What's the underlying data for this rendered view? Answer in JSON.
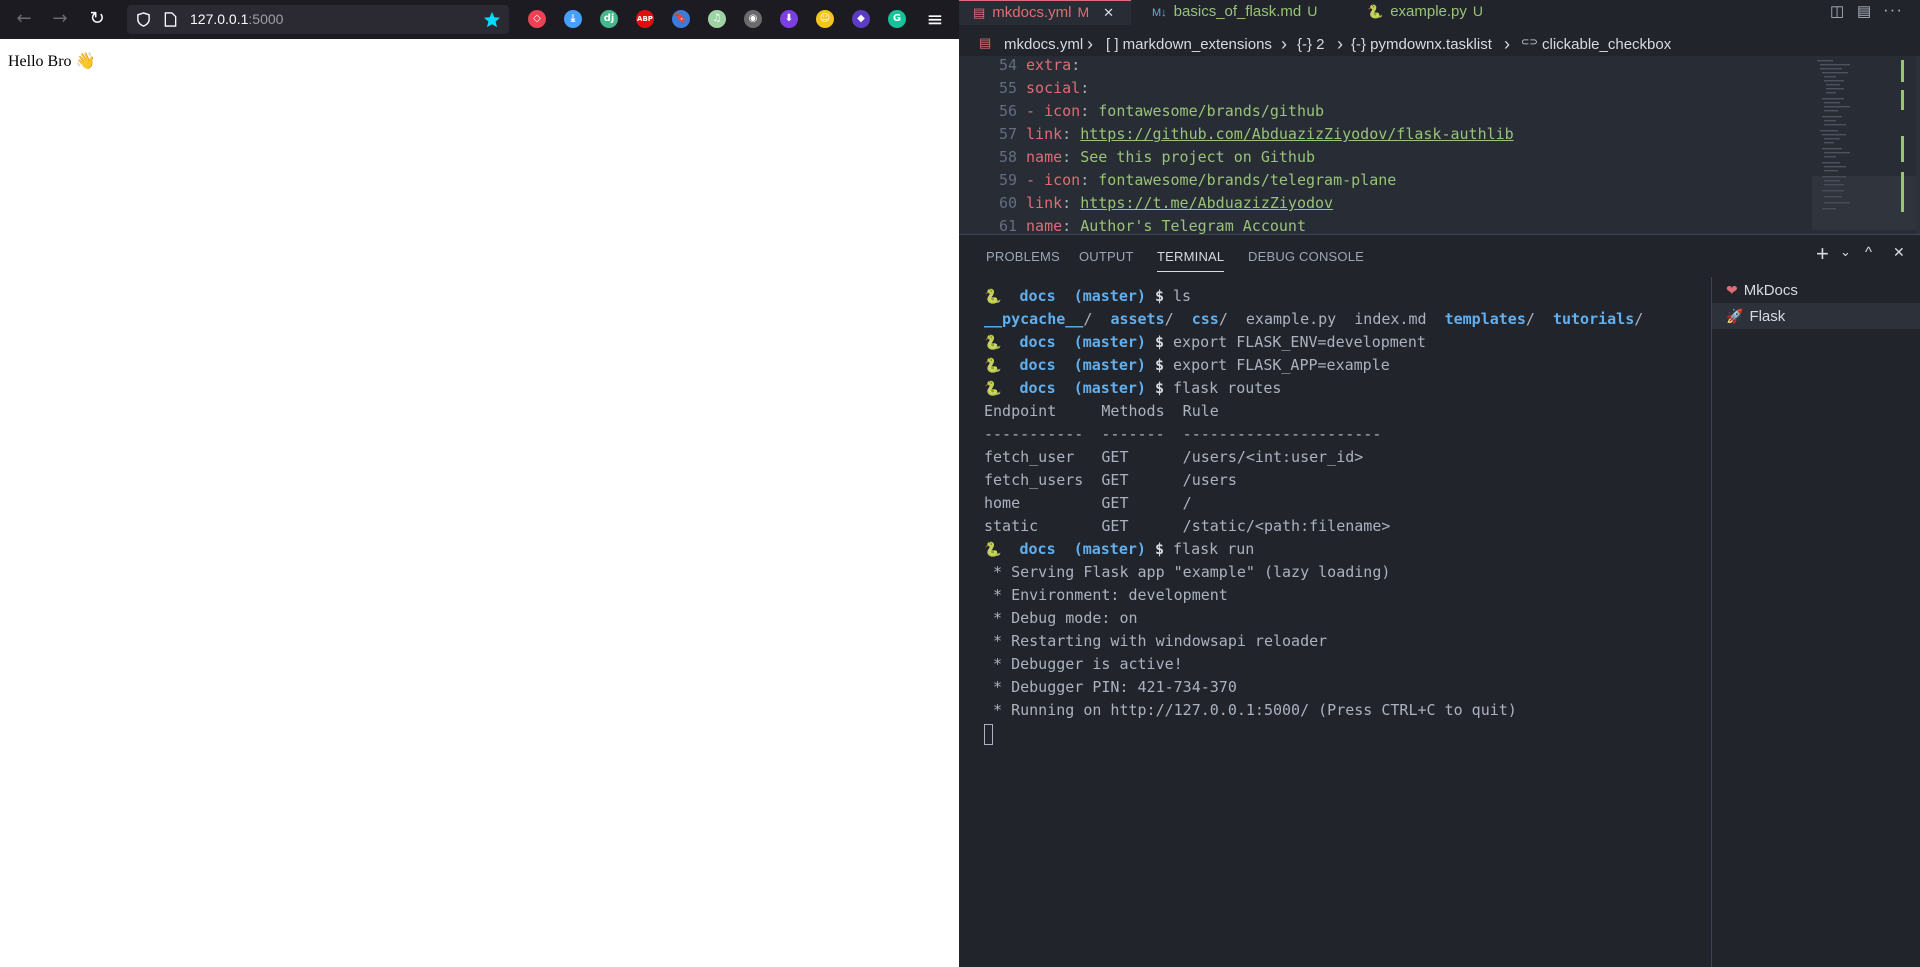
{
  "browser": {
    "url_host": "127.0.0.1",
    "url_port": ":5000",
    "page_text": "Hello Bro",
    "page_emoji": "👋",
    "nav": {
      "back": "←",
      "forward": "→",
      "reload": "↻"
    },
    "menu_icon": "≡",
    "extensions": [
      {
        "name": "pocket-icon",
        "glyph": "◇",
        "color": "#ef4056"
      },
      {
        "name": "download-icon",
        "glyph": "⤓",
        "color": "#45a1ff"
      },
      {
        "name": "dj-icon",
        "glyph": "dj",
        "color": "#44b78b"
      },
      {
        "name": "adblock-icon",
        "glyph": "ABP",
        "color": "#e40d0d"
      },
      {
        "name": "bookmark-icon",
        "glyph": "🔖",
        "color": "#3b7bdc"
      },
      {
        "name": "music-icon",
        "glyph": "♫",
        "color": "#9fd3a6"
      },
      {
        "name": "spy-icon",
        "glyph": "◉",
        "color": "#6b6b6b"
      },
      {
        "name": "ext-download-icon",
        "glyph": "⬇",
        "color": "#7b3fe4"
      },
      {
        "name": "emoji-icon",
        "glyph": "☺",
        "color": "#f5c518"
      },
      {
        "name": "layers-icon",
        "glyph": "◆",
        "color": "#5b3cc4"
      },
      {
        "name": "grammarly-icon",
        "glyph": "G",
        "color": "#15c39a"
      }
    ]
  },
  "vscode": {
    "tabs": [
      {
        "label": "mkdocs.yml",
        "badge": "M",
        "color": "#e06c75",
        "icon": "▤"
      },
      {
        "label": "basics_of_flask.md",
        "badge": "U",
        "color": "#98c379",
        "icon": "M↓"
      },
      {
        "label": "example.py",
        "badge": "U",
        "color": "#98c379",
        "icon": "🐍"
      }
    ],
    "breadcrumb": [
      "mkdocs.yml",
      "[ ] markdown_extensions",
      "{-} 2",
      "{-} pymdownx.tasklist",
      "clickable_checkbox"
    ],
    "code": [
      {
        "n": "54",
        "indent": "  ",
        "parts": [
          [
            "k",
            "extra"
          ],
          [
            "p",
            ":"
          ]
        ]
      },
      {
        "n": "55",
        "indent": "    ",
        "parts": [
          [
            "k",
            "social"
          ],
          [
            "p",
            ":"
          ]
        ]
      },
      {
        "n": "56",
        "indent": "      ",
        "parts": [
          [
            "k",
            "- icon"
          ],
          [
            "p",
            ": "
          ],
          [
            "s",
            "fontawesome/brands/github"
          ]
        ]
      },
      {
        "n": "57",
        "indent": "        ",
        "parts": [
          [
            "k",
            "link"
          ],
          [
            "p",
            ": "
          ],
          [
            "u",
            "https://github.com/AbduazizZiyodov/flask-authlib"
          ]
        ]
      },
      {
        "n": "58",
        "indent": "        ",
        "parts": [
          [
            "k",
            "name"
          ],
          [
            "p",
            ": "
          ],
          [
            "s",
            "See this project on Github"
          ]
        ]
      },
      {
        "n": "59",
        "indent": "      ",
        "parts": [
          [
            "k",
            "- icon"
          ],
          [
            "p",
            ": "
          ],
          [
            "s",
            "fontawesome/brands/telegram-plane"
          ]
        ]
      },
      {
        "n": "60",
        "indent": "        ",
        "parts": [
          [
            "k",
            "link"
          ],
          [
            "p",
            ": "
          ],
          [
            "u",
            "https://t.me/AbduazizZiyodov"
          ]
        ]
      },
      {
        "n": "61",
        "indent": "        ",
        "parts": [
          [
            "k",
            "name"
          ],
          [
            "p",
            ": "
          ],
          [
            "s",
            "Author's Telegram Account"
          ]
        ]
      }
    ],
    "panel_tabs": [
      "PROBLEMS",
      "OUTPUT",
      "TERMINAL",
      "DEBUG CONSOLE"
    ],
    "active_panel_tab": "TERMINAL",
    "panel_actions": {
      "add": "+",
      "chevron": "⌄",
      "maximize": "^",
      "close": "✕"
    },
    "terminals": [
      {
        "label": "MkDocs",
        "icon": "❤"
      },
      {
        "label": "Flask",
        "icon": "🚀"
      }
    ],
    "terminal_lines": [
      {
        "type": "prompt",
        "dir": "docs",
        "branch": "(master)",
        "cmd": "ls"
      },
      {
        "type": "ls",
        "items": [
          [
            "__pycache__",
            "dir"
          ],
          [
            "/",
            "p"
          ],
          [
            "  ",
            "p"
          ],
          [
            "assets",
            "dir"
          ],
          [
            "/",
            "p"
          ],
          [
            "  ",
            "p"
          ],
          [
            "css",
            "dir"
          ],
          [
            "/",
            "p"
          ],
          [
            "  example.py  index.md  ",
            "p"
          ],
          [
            "templates",
            "dir"
          ],
          [
            "/",
            "p"
          ],
          [
            "  ",
            "p"
          ],
          [
            "tutorials",
            "dir"
          ],
          [
            "/",
            "p"
          ]
        ]
      },
      {
        "type": "prompt",
        "dir": "docs",
        "branch": "(master)",
        "cmd": "export FLASK_ENV=development"
      },
      {
        "type": "prompt",
        "dir": "docs",
        "branch": "(master)",
        "cmd": "export FLASK_APP=example"
      },
      {
        "type": "prompt",
        "dir": "docs",
        "branch": "(master)",
        "cmd": "flask routes"
      },
      {
        "type": "text",
        "text": "Endpoint     Methods  Rule"
      },
      {
        "type": "text",
        "text": "-----------  -------  ----------------------"
      },
      {
        "type": "text",
        "text": "fetch_user   GET      /users/<int:user_id>"
      },
      {
        "type": "text",
        "text": "fetch_users  GET      /users"
      },
      {
        "type": "text",
        "text": "home         GET      /"
      },
      {
        "type": "text",
        "text": "static       GET      /static/<path:filename>"
      },
      {
        "type": "prompt",
        "dir": "docs",
        "branch": "(master)",
        "cmd": "flask run"
      },
      {
        "type": "text",
        "text": " * Serving Flask app \"example\" (lazy loading)"
      },
      {
        "type": "text",
        "text": " * Environment: development"
      },
      {
        "type": "text",
        "text": " * Debug mode: on"
      },
      {
        "type": "text",
        "text": " * Restarting with windowsapi reloader"
      },
      {
        "type": "text",
        "text": " * Debugger is active!"
      },
      {
        "type": "text",
        "text": " * Debugger PIN: 421-734-370"
      },
      {
        "type": "text",
        "text": " * Running on http://127.0.0.1:5000/ (Press CTRL+C to quit)"
      }
    ],
    "accent_color": "#e06c75"
  }
}
